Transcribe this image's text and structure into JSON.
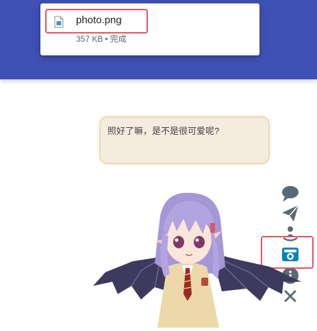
{
  "download": {
    "file_name": "photo.png",
    "file_size": "357 KB",
    "separator": "•",
    "status": "完成",
    "file_icon": "image-file-icon"
  },
  "live2d": {
    "message": "照好了嘛，是不是很可爱呢?",
    "tools": [
      {
        "name": "chat-icon"
      },
      {
        "name": "paper-plane-icon"
      },
      {
        "name": "user-circle-icon"
      },
      {
        "name": "camera-icon"
      },
      {
        "name": "info-icon"
      },
      {
        "name": "close-icon"
      }
    ]
  },
  "colors": {
    "header_band": "#3f51b5",
    "bubble_bg": "#f5ece0",
    "bubble_border": "#eed8b2",
    "tool_gray": "#5a6a75",
    "tool_active": "#0684bd",
    "highlight": "#e8515f"
  }
}
